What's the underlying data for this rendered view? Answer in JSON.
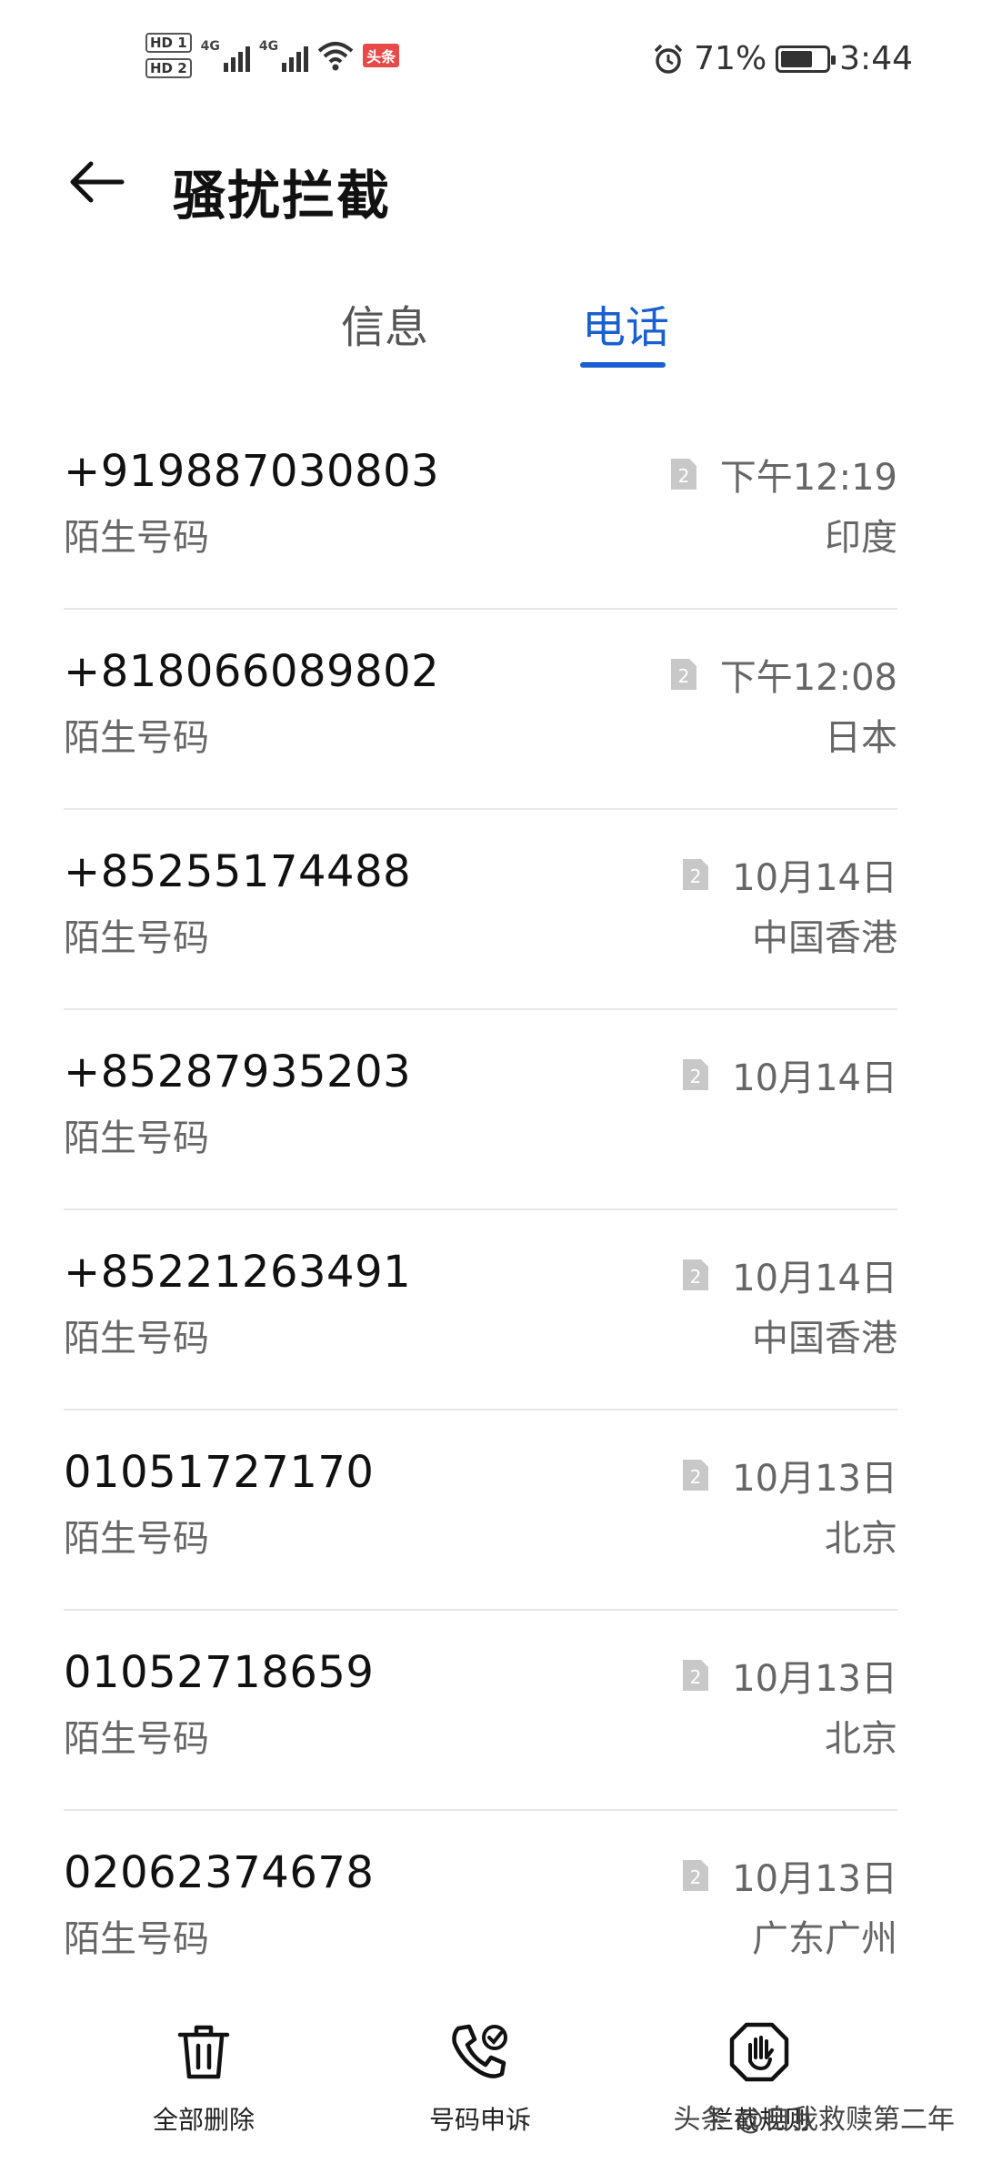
{
  "status_bar": {
    "hd1": "HD 1",
    "hd2": "HD 2",
    "net1": "4G",
    "net2": "4G",
    "news_badge": "头条",
    "battery": "71%",
    "time": "3:44",
    "icons": [
      "alarm-icon",
      "wifi-icon",
      "battery-icon",
      "signal-icon"
    ]
  },
  "header": {
    "title": "骚扰拦截",
    "back_icon": "arrow-left-icon"
  },
  "tabs": [
    {
      "label": "信息",
      "active": false
    },
    {
      "label": "电话",
      "active": true
    }
  ],
  "accent_color": "#1a5fd0",
  "calls": [
    {
      "number": "+919887030803",
      "tag": "陌生号码",
      "sim": "2",
      "time": "下午12:19",
      "location": "印度"
    },
    {
      "number": "+818066089802",
      "tag": "陌生号码",
      "sim": "2",
      "time": "下午12:08",
      "location": "日本"
    },
    {
      "number": "+85255174488",
      "tag": "陌生号码",
      "sim": "2",
      "time": "10月14日",
      "location": "中国香港"
    },
    {
      "number": "+85287935203",
      "tag": "陌生号码",
      "sim": "2",
      "time": "10月14日",
      "location": ""
    },
    {
      "number": "+85221263491",
      "tag": "陌生号码",
      "sim": "2",
      "time": "10月14日",
      "location": "中国香港"
    },
    {
      "number": "01051727170",
      "tag": "陌生号码",
      "sim": "2",
      "time": "10月13日",
      "location": "北京"
    },
    {
      "number": "01052718659",
      "tag": "陌生号码",
      "sim": "2",
      "time": "10月13日",
      "location": "北京"
    },
    {
      "number": "02062374678",
      "tag": "陌生号码",
      "sim": "2",
      "time": "10月13日",
      "location": "广东广州"
    }
  ],
  "bottom_actions": [
    {
      "label": "全部删除",
      "icon": "trash-icon"
    },
    {
      "label": "号码申诉",
      "icon": "phone-appeal-icon"
    },
    {
      "label": "拦截规则",
      "icon": "hand-stop-icon"
    }
  ],
  "watermark": "头条 @自我救赎第二年"
}
